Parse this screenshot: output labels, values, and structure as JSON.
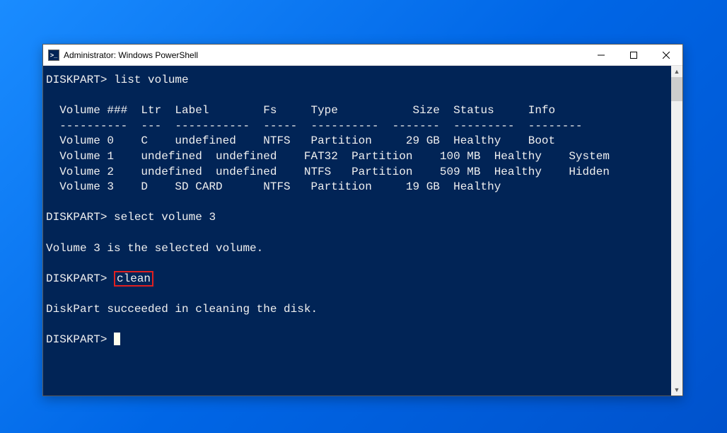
{
  "window": {
    "title": "Administrator: Windows PowerShell",
    "icon_label": ">_"
  },
  "terminal": {
    "prompt": "DISKPART>",
    "cmd1": "list volume",
    "header": {
      "col1": "Volume ###",
      "col2": "Ltr",
      "col3": "Label",
      "col4": "Fs",
      "col5": "Type",
      "col6": "Size",
      "col7": "Status",
      "col8": "Info"
    },
    "sep": {
      "col1": "----------",
      "col2": "---",
      "col3": "-----------",
      "col4": "-----",
      "col5": "----------",
      "col6": "-------",
      "col7": "---------",
      "col8": "--------"
    },
    "rows": [
      {
        "vol": "Volume 0",
        "ltr": "C",
        "label": "",
        "fs": "NTFS",
        "type": "Partition",
        "size": "29 GB",
        "status": "Healthy",
        "info": "Boot"
      },
      {
        "vol": "Volume 1",
        "ltr": "",
        "label": "",
        "fs": "FAT32",
        "type": "Partition",
        "size": "100 MB",
        "status": "Healthy",
        "info": "System"
      },
      {
        "vol": "Volume 2",
        "ltr": "",
        "label": "",
        "fs": "NTFS",
        "type": "Partition",
        "size": "509 MB",
        "status": "Healthy",
        "info": "Hidden"
      },
      {
        "vol": "Volume 3",
        "ltr": "D",
        "label": "SD CARD",
        "fs": "NTFS",
        "type": "Partition",
        "size": "19 GB",
        "status": "Healthy",
        "info": ""
      }
    ],
    "cmd2": "select volume 3",
    "response1": "Volume 3 is the selected volume.",
    "cmd3": "clean",
    "response2": "DiskPart succeeded in cleaning the disk."
  }
}
